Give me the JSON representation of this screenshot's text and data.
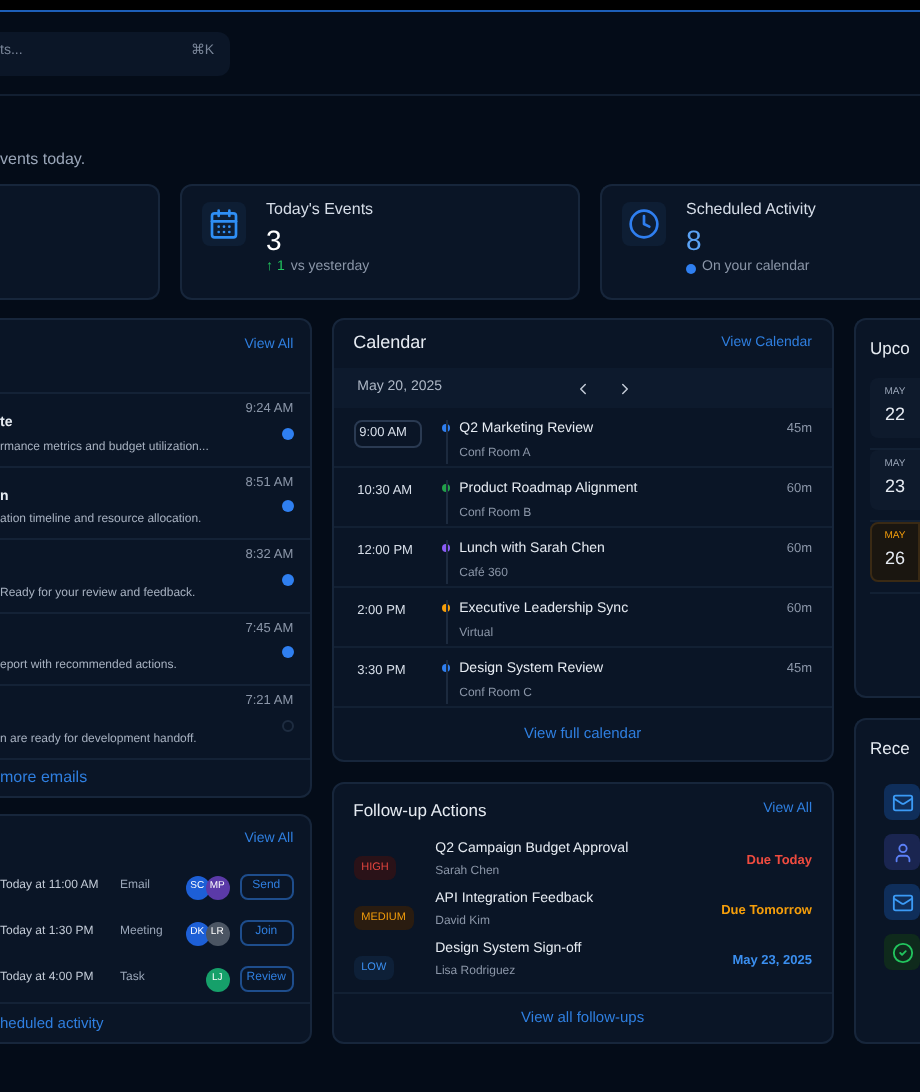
{
  "search": {
    "placeholder": "ts...",
    "shortcut": "⌘K"
  },
  "subtitle": "vents today.",
  "stats": [
    {
      "kind": "events",
      "label": "Today's Events",
      "value": "3",
      "delta": "↑ 1",
      "note": "vs yesterday"
    },
    {
      "kind": "activity",
      "label": "Scheduled Activity",
      "value": "8",
      "note": "On your calendar"
    }
  ],
  "emails": {
    "action": "View All",
    "items": [
      {
        "title": "te",
        "preview": "rmance metrics and budget utilization...",
        "time": "9:24 AM",
        "unread": true
      },
      {
        "title": "n",
        "preview": "ation timeline and resource allocation.",
        "time": "8:51 AM",
        "unread": true
      },
      {
        "preview": "Ready for your review and feedback.",
        "time": "8:32 AM",
        "unread": true
      },
      {
        "preview": "eport with recommended actions.",
        "time": "7:45 AM",
        "unread": true
      },
      {
        "preview": "n are ready for development handoff.",
        "time": "7:21 AM",
        "unread": false
      }
    ],
    "footer": "more emails"
  },
  "activity": {
    "action": "View All",
    "items": [
      {
        "when": "Today at 11:00 AM",
        "type": "Email",
        "people": [
          {
            "initials": "SC",
            "color": "#1d5fd6"
          },
          {
            "initials": "MP",
            "color": "#5b3aa8"
          }
        ],
        "button": "Send"
      },
      {
        "when": "Today at 1:30 PM",
        "type": "Meeting",
        "people": [
          {
            "initials": "DK",
            "color": "#1d5fd6"
          },
          {
            "initials": "LR",
            "color": "#4b5563"
          }
        ],
        "button": "Join"
      },
      {
        "when": "Today at 4:00 PM",
        "type": "Task",
        "people": [
          {
            "initials": "LJ",
            "color": "#16a06a"
          }
        ],
        "button": "Review"
      }
    ],
    "footer": "heduled activity"
  },
  "calendar": {
    "title": "Calendar",
    "action": "View Calendar",
    "date": "May 20, 2025",
    "events": [
      {
        "time": "9:00 AM",
        "title": "Q2 Marketing Review",
        "place": "Conf Room A",
        "duration": "45m",
        "color": "#2f7ff0",
        "selected": true
      },
      {
        "time": "10:30 AM",
        "title": "Product Roadmap Alignment",
        "place": "Conf Room B",
        "duration": "60m",
        "color": "#22a04a",
        "selected": false
      },
      {
        "time": "12:00 PM",
        "title": "Lunch with Sarah Chen",
        "place": "Café 360",
        "duration": "60m",
        "color": "#8b5cf6",
        "selected": false
      },
      {
        "time": "2:00 PM",
        "title": "Executive Leadership Sync",
        "place": "Virtual",
        "duration": "60m",
        "color": "#f59e0b",
        "selected": false
      },
      {
        "time": "3:30 PM",
        "title": "Design System Review",
        "place": "Conf Room C",
        "duration": "45m",
        "color": "#2f7ff0",
        "selected": false
      }
    ],
    "footer": "View full calendar"
  },
  "followups": {
    "title": "Follow-up Actions",
    "action": "View All",
    "items": [
      {
        "kind": "high",
        "priority": "HIGH",
        "title": "Q2 Campaign Budget Approval",
        "person": "Sarah Chen",
        "due": "Due Today"
      },
      {
        "kind": "medium",
        "priority": "MEDIUM",
        "title": "API Integration Feedback",
        "person": "David Kim",
        "due": "Due Tomorrow"
      },
      {
        "kind": "low",
        "priority": "LOW",
        "title": "Design System Sign-off",
        "person": "Lisa Rodriguez",
        "due": "May 23, 2025"
      }
    ],
    "footer": "View all follow-ups"
  },
  "upcoming": {
    "title": "Upco",
    "items": [
      {
        "month": "MAY",
        "day": "22",
        "highlight": false
      },
      {
        "month": "MAY",
        "day": "23",
        "highlight": false
      },
      {
        "month": "MAY",
        "day": "26",
        "highlight": true
      }
    ]
  },
  "recent": {
    "title": "Rece",
    "items": [
      {
        "kind": "mail"
      },
      {
        "kind": "user"
      },
      {
        "kind": "mail"
      },
      {
        "kind": "task"
      }
    ]
  }
}
